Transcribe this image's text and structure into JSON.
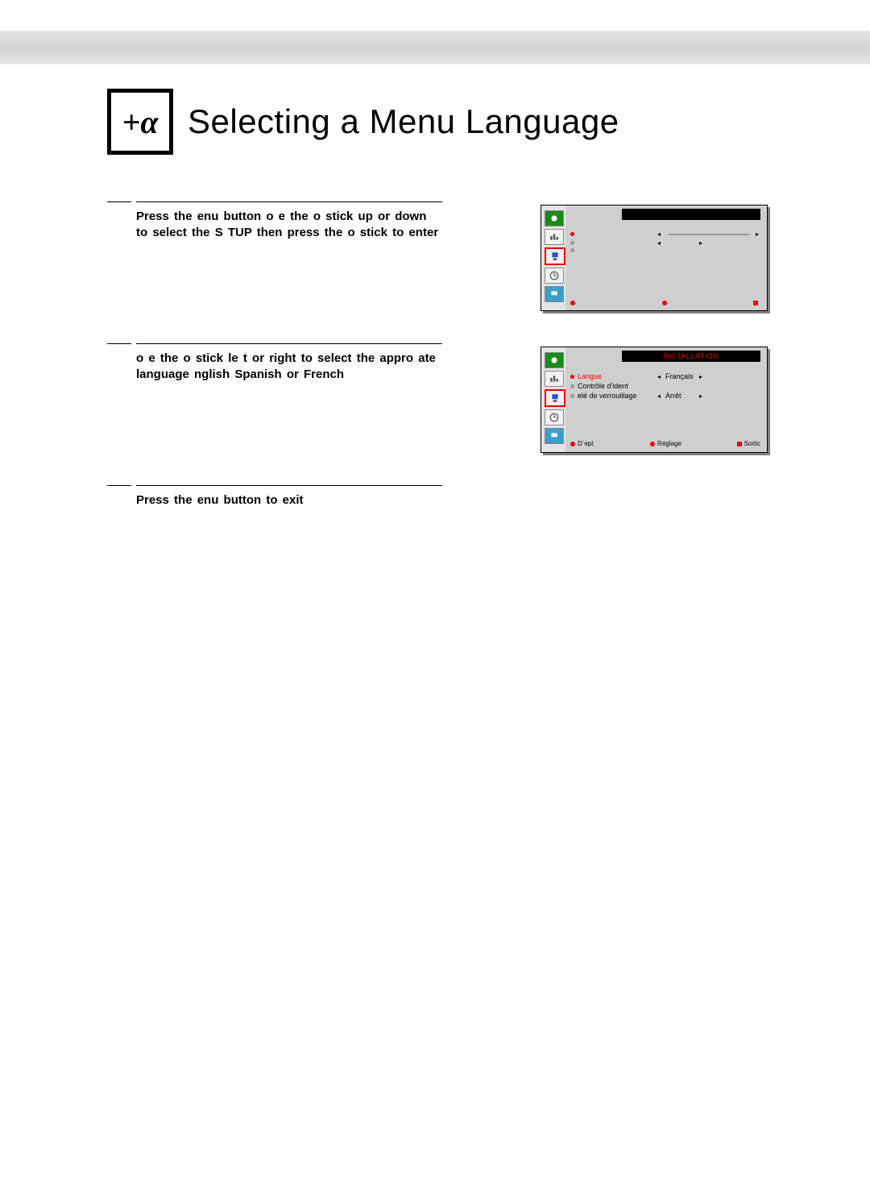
{
  "icon": "+α",
  "title": "Selecting a Menu Language",
  "steps": [
    {
      "num": "",
      "text": "Press the  enu button  o e the  o stick up or down to select the S TUP  then press the  o stick to enter",
      "osd": {
        "title": "",
        "rows": [
          {
            "label": "",
            "value": "",
            "slider": true,
            "active": true
          },
          {
            "label": "",
            "value": "",
            "slider": false,
            "active": false
          },
          {
            "label": "",
            "value": "",
            "slider": false,
            "active": false
          }
        ],
        "footer": [
          {
            "sym": "dot",
            "label": ""
          },
          {
            "sym": "dot",
            "label": ""
          },
          {
            "sym": "sq",
            "label": ""
          }
        ],
        "sidebar_selected": 2
      }
    },
    {
      "num": "",
      "text": " o e the  o stick le t or right to select the appro  ate language   nglish  Spanish  or French",
      "osd": {
        "title": "INSTALLATION",
        "rows": [
          {
            "label": "Langue",
            "value": "Français",
            "active": true
          },
          {
            "label": "Contrôle d'ident",
            "value": "",
            "active": false
          },
          {
            "label": "elé de verrouillage",
            "value": "Arrêt",
            "active": false
          }
        ],
        "footer": [
          {
            "sym": "dot",
            "label": "D´epl."
          },
          {
            "sym": "dot",
            "label": "Réglage"
          },
          {
            "sym": "sq",
            "label": "Sortic"
          }
        ],
        "sidebar_selected": 2
      }
    },
    {
      "num": "",
      "text": "Press the  enu button to exit",
      "osd": null
    }
  ],
  "sidebar_icons": [
    "picture-icon",
    "sound-icon",
    "setup-icon",
    "clock-icon",
    "input-icon"
  ]
}
